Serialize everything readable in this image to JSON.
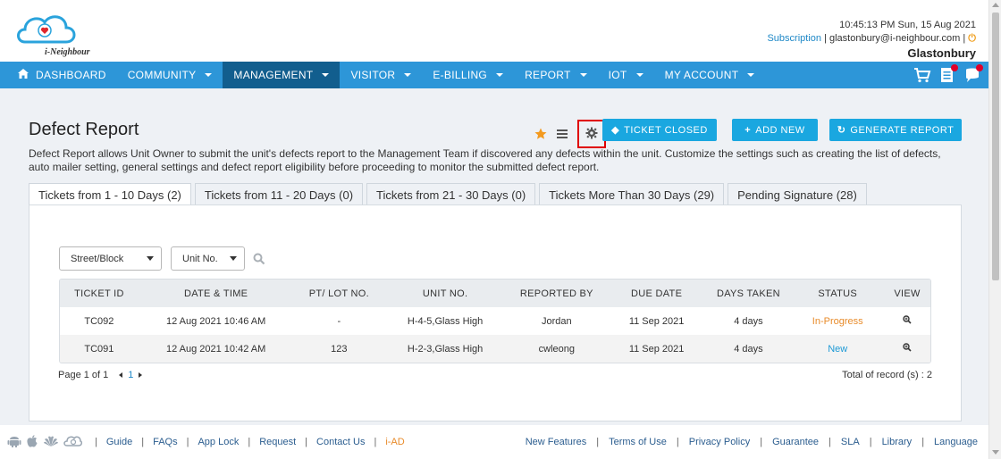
{
  "header": {
    "logo_text": "i-Neighbour",
    "datetime": "10:45:13 PM  Sun, 15 Aug 2021",
    "subscription": "Subscription",
    "email": "glastonbury@i-neighbour.com",
    "estate": "Glastonbury"
  },
  "nav": {
    "items": [
      "DASHBOARD",
      "COMMUNITY",
      "MANAGEMENT",
      "VISITOR",
      "E-BILLING",
      "REPORT",
      "IOT",
      "MY ACCOUNT"
    ],
    "active": "MANAGEMENT"
  },
  "page": {
    "title": "Defect Report",
    "description": "Defect Report allows Unit Owner to submit the unit's defects report to the Management Team if discovered any defects within the unit. Customize the settings such as creating the list of defects, auto mailer setting, general settings and defect report eligibility before proceeding to monitor the submitted defect report.",
    "buttons": {
      "ticket_closed": "TICKET CLOSED",
      "add_new": "ADD NEW",
      "generate_report": "GENERATE REPORT"
    }
  },
  "tabs": [
    "Tickets from 1 - 10 Days (2)",
    "Tickets from 11 - 20 Days (0)",
    "Tickets from 21 - 30 Days (0)",
    "Tickets More Than 30 Days (29)",
    "Pending Signature (28)"
  ],
  "filters": {
    "street_block": "Street/Block",
    "unit_no": "Unit No."
  },
  "table": {
    "headers": [
      "TICKET ID",
      "DATE & TIME",
      "PT/ LOT NO.",
      "UNIT NO.",
      "REPORTED BY",
      "DUE DATE",
      "DAYS TAKEN",
      "STATUS",
      "VIEW"
    ],
    "rows": [
      [
        "TC092",
        "12 Aug 2021 10:46 AM",
        "-",
        "H-4-5,Glass High",
        "Jordan",
        "11 Sep 2021",
        "4 days",
        "In-Progress"
      ],
      [
        "TC091",
        "12 Aug 2021 10:42 AM",
        "123",
        "H-2-3,Glass High",
        "cwleong",
        "11 Sep 2021",
        "4 days",
        "New"
      ]
    ]
  },
  "pager": {
    "page_text": "Page 1 of 1",
    "current": "1",
    "total_text": "Total of record (s) : 2"
  },
  "footer": {
    "left_links": [
      "Guide",
      "FAQs",
      "App Lock",
      "Request",
      "Contact Us",
      "i-AD"
    ],
    "right_links": [
      "New Features",
      "Terms of Use",
      "Privacy Policy",
      "Guarantee",
      "SLA",
      "Library",
      "Language"
    ]
  },
  "colors": {
    "nav_bg": "#2d96d8",
    "nav_active": "#125e8e",
    "button_bg": "#1aa7e0",
    "status_progress": "#e88b2a",
    "status_new": "#1e9ad6",
    "highlight_box": "#e00000"
  }
}
